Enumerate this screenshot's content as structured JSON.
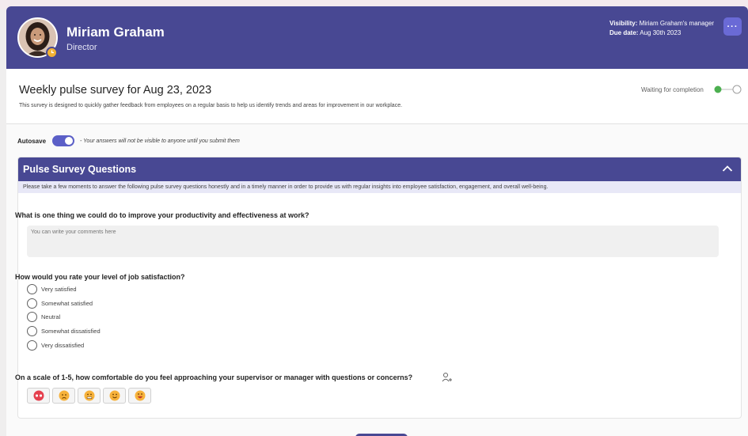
{
  "header": {
    "user_name": "Miriam Graham",
    "user_title": "Director",
    "visibility_label": "Visibility:",
    "visibility_value": "Miriam Graham's manager",
    "due_label": "Due date:",
    "due_value": "Aug 30th 2023",
    "more_label": "···",
    "header_color": "#484893",
    "avatar_icon": "user-avatar",
    "status_icon": "clock-status-icon"
  },
  "survey": {
    "title": "Weekly pulse survey for Aug 23, 2023",
    "description": "This survey is designed to quickly gather feedback from employees on a regular basis to help us identify trends and areas for improvement in our workplace.",
    "status_label": "Waiting for completion",
    "status_color": "#4caf50"
  },
  "autosave": {
    "label": "Autosave",
    "enabled": true,
    "note": "- Your answers will not be visible to anyone until you submit them",
    "accent": "#5b5fc7"
  },
  "section": {
    "title": "Pulse Survey Questions",
    "intro": "Please take a few moments to answer the following pulse survey questions honestly and in a timely manner in order to provide us with regular insights into employee satisfaction, engagement, and overall well-being.",
    "collapse_icon": "chevron-up-icon"
  },
  "questions": [
    {
      "text": "What is one thing we could do to improve your productivity and effectiveness at work?",
      "type": "text",
      "placeholder": "You can write your comments here"
    },
    {
      "text": "How would you rate your level of job satisfaction?",
      "type": "choice",
      "options": [
        "Very satisfied",
        "Somewhat satisfied",
        "Neutral",
        "Somewhat dissatisfied",
        "Very dissatisfied"
      ]
    },
    {
      "text": "On a scale of 1-5, how comfortable do you feel approaching your supervisor or manager with questions or concerns?",
      "type": "rating",
      "helper_icon": "person-sparkle-icon",
      "ratings": [
        "angry-face-icon",
        "sad-face-icon",
        "grimace-face-icon",
        "smile-face-icon",
        "grin-face-icon"
      ]
    }
  ]
}
